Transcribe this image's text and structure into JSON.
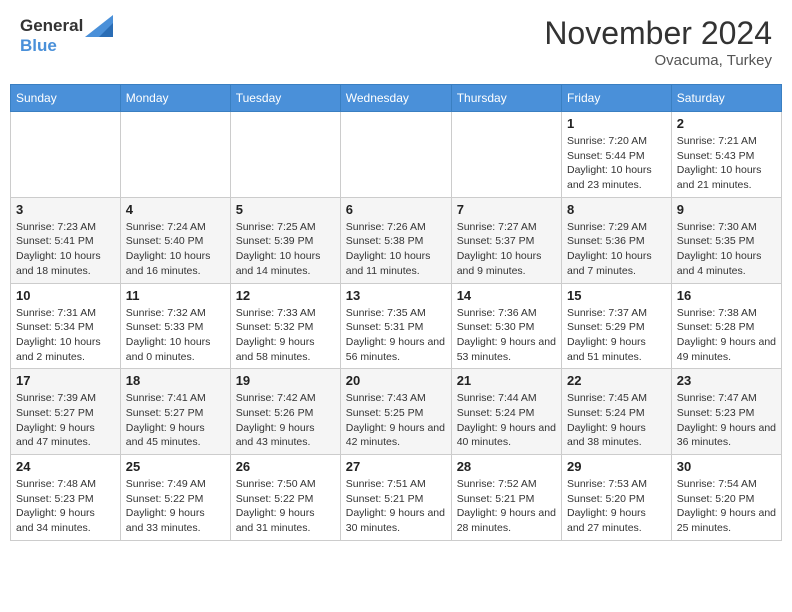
{
  "header": {
    "logo_general": "General",
    "logo_blue": "Blue",
    "month_title": "November 2024",
    "location": "Ovacuma, Turkey"
  },
  "days_of_week": [
    "Sunday",
    "Monday",
    "Tuesday",
    "Wednesday",
    "Thursday",
    "Friday",
    "Saturday"
  ],
  "weeks": [
    [
      {
        "day": "",
        "info": ""
      },
      {
        "day": "",
        "info": ""
      },
      {
        "day": "",
        "info": ""
      },
      {
        "day": "",
        "info": ""
      },
      {
        "day": "",
        "info": ""
      },
      {
        "day": "1",
        "info": "Sunrise: 7:20 AM\nSunset: 5:44 PM\nDaylight: 10 hours and 23 minutes."
      },
      {
        "day": "2",
        "info": "Sunrise: 7:21 AM\nSunset: 5:43 PM\nDaylight: 10 hours and 21 minutes."
      }
    ],
    [
      {
        "day": "3",
        "info": "Sunrise: 7:23 AM\nSunset: 5:41 PM\nDaylight: 10 hours and 18 minutes."
      },
      {
        "day": "4",
        "info": "Sunrise: 7:24 AM\nSunset: 5:40 PM\nDaylight: 10 hours and 16 minutes."
      },
      {
        "day": "5",
        "info": "Sunrise: 7:25 AM\nSunset: 5:39 PM\nDaylight: 10 hours and 14 minutes."
      },
      {
        "day": "6",
        "info": "Sunrise: 7:26 AM\nSunset: 5:38 PM\nDaylight: 10 hours and 11 minutes."
      },
      {
        "day": "7",
        "info": "Sunrise: 7:27 AM\nSunset: 5:37 PM\nDaylight: 10 hours and 9 minutes."
      },
      {
        "day": "8",
        "info": "Sunrise: 7:29 AM\nSunset: 5:36 PM\nDaylight: 10 hours and 7 minutes."
      },
      {
        "day": "9",
        "info": "Sunrise: 7:30 AM\nSunset: 5:35 PM\nDaylight: 10 hours and 4 minutes."
      }
    ],
    [
      {
        "day": "10",
        "info": "Sunrise: 7:31 AM\nSunset: 5:34 PM\nDaylight: 10 hours and 2 minutes."
      },
      {
        "day": "11",
        "info": "Sunrise: 7:32 AM\nSunset: 5:33 PM\nDaylight: 10 hours and 0 minutes."
      },
      {
        "day": "12",
        "info": "Sunrise: 7:33 AM\nSunset: 5:32 PM\nDaylight: 9 hours and 58 minutes."
      },
      {
        "day": "13",
        "info": "Sunrise: 7:35 AM\nSunset: 5:31 PM\nDaylight: 9 hours and 56 minutes."
      },
      {
        "day": "14",
        "info": "Sunrise: 7:36 AM\nSunset: 5:30 PM\nDaylight: 9 hours and 53 minutes."
      },
      {
        "day": "15",
        "info": "Sunrise: 7:37 AM\nSunset: 5:29 PM\nDaylight: 9 hours and 51 minutes."
      },
      {
        "day": "16",
        "info": "Sunrise: 7:38 AM\nSunset: 5:28 PM\nDaylight: 9 hours and 49 minutes."
      }
    ],
    [
      {
        "day": "17",
        "info": "Sunrise: 7:39 AM\nSunset: 5:27 PM\nDaylight: 9 hours and 47 minutes."
      },
      {
        "day": "18",
        "info": "Sunrise: 7:41 AM\nSunset: 5:27 PM\nDaylight: 9 hours and 45 minutes."
      },
      {
        "day": "19",
        "info": "Sunrise: 7:42 AM\nSunset: 5:26 PM\nDaylight: 9 hours and 43 minutes."
      },
      {
        "day": "20",
        "info": "Sunrise: 7:43 AM\nSunset: 5:25 PM\nDaylight: 9 hours and 42 minutes."
      },
      {
        "day": "21",
        "info": "Sunrise: 7:44 AM\nSunset: 5:24 PM\nDaylight: 9 hours and 40 minutes."
      },
      {
        "day": "22",
        "info": "Sunrise: 7:45 AM\nSunset: 5:24 PM\nDaylight: 9 hours and 38 minutes."
      },
      {
        "day": "23",
        "info": "Sunrise: 7:47 AM\nSunset: 5:23 PM\nDaylight: 9 hours and 36 minutes."
      }
    ],
    [
      {
        "day": "24",
        "info": "Sunrise: 7:48 AM\nSunset: 5:23 PM\nDaylight: 9 hours and 34 minutes."
      },
      {
        "day": "25",
        "info": "Sunrise: 7:49 AM\nSunset: 5:22 PM\nDaylight: 9 hours and 33 minutes."
      },
      {
        "day": "26",
        "info": "Sunrise: 7:50 AM\nSunset: 5:22 PM\nDaylight: 9 hours and 31 minutes."
      },
      {
        "day": "27",
        "info": "Sunrise: 7:51 AM\nSunset: 5:21 PM\nDaylight: 9 hours and 30 minutes."
      },
      {
        "day": "28",
        "info": "Sunrise: 7:52 AM\nSunset: 5:21 PM\nDaylight: 9 hours and 28 minutes."
      },
      {
        "day": "29",
        "info": "Sunrise: 7:53 AM\nSunset: 5:20 PM\nDaylight: 9 hours and 27 minutes."
      },
      {
        "day": "30",
        "info": "Sunrise: 7:54 AM\nSunset: 5:20 PM\nDaylight: 9 hours and 25 minutes."
      }
    ]
  ]
}
